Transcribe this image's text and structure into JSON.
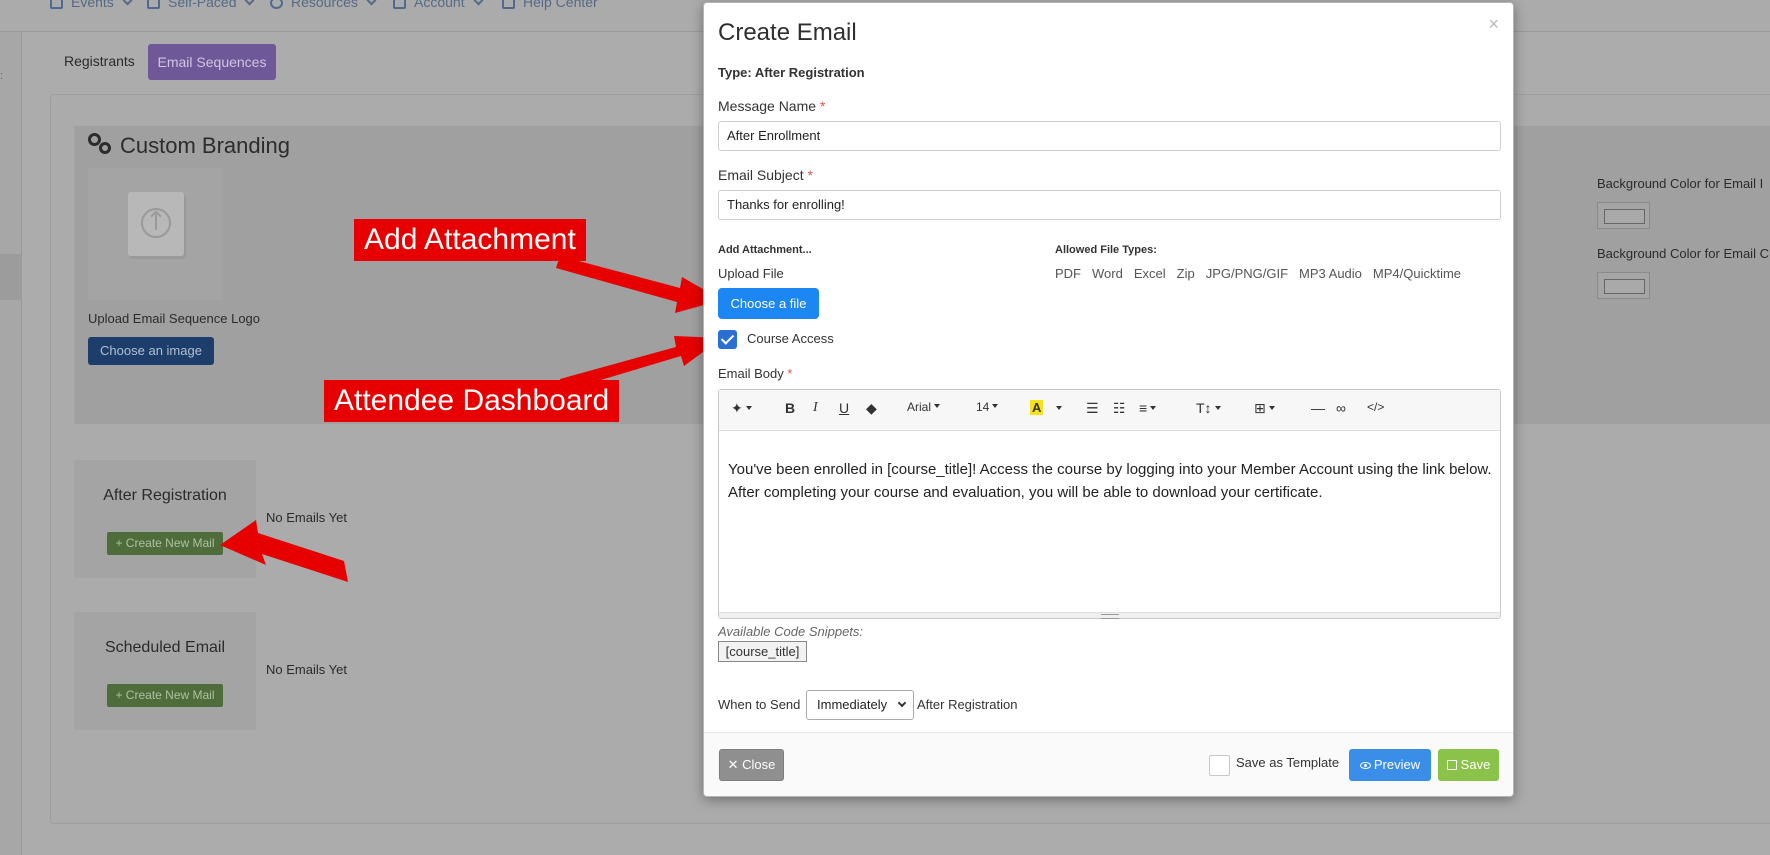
{
  "nav": {
    "items": [
      {
        "label": "Events"
      },
      {
        "label": "Self-Paced"
      },
      {
        "label": "Resources"
      },
      {
        "label": "Account"
      },
      {
        "label": "Help Center"
      }
    ]
  },
  "tabs": {
    "registrants": "Registrants",
    "email_sequences": "Email Sequences"
  },
  "branding": {
    "title": "Custom Branding",
    "upload_logo_label": "Upload Email Sequence Logo",
    "choose_image": "Choose an image",
    "bg_color_label_1": "Background Color for Email I",
    "bg_color_label_2": "Background Color for Email C"
  },
  "sequences": [
    {
      "title": "After Registration",
      "button": "+ Create New Mail",
      "empty": "No Emails Yet"
    },
    {
      "title": "Scheduled Email",
      "button": "+ Create New Mail",
      "empty": "No Emails Yet"
    }
  ],
  "annotations": {
    "add_attachment": "Add Attachment",
    "attendee_dashboard": "Attendee Dashboard",
    "color": "#e60000"
  },
  "modal": {
    "title": "Create Email",
    "close_x": "×",
    "type_line": "Type: After Registration",
    "message_name_label": "Message Name",
    "message_name_value": "After Enrollment",
    "required_mark": "*",
    "email_subject_label": "Email Subject",
    "email_subject_value": "Thanks for enrolling!",
    "add_attachment_label": "Add Attachment...",
    "upload_file_label": "Upload File",
    "choose_file": "Choose a file",
    "allowed_types_label": "Allowed File Types:",
    "allowed_types": [
      "PDF",
      "Word",
      "Excel",
      "Zip",
      "JPG/PNG/GIF",
      "MP3 Audio",
      "MP4/Quicktime"
    ],
    "course_access_label": "Course Access",
    "course_access_checked": true,
    "email_body_label": "Email Body",
    "toolbar": {
      "font": "Arial",
      "size": "14",
      "bold": "B",
      "italic": "I",
      "underline": "U",
      "color_letter": "A",
      "text_size": "T↕",
      "code": "</>"
    },
    "body_text": "You've been enrolled in [course_title]! Access the course by logging into your Member Account using the link below. After completing your course and evaluation, you will be able to download your certificate.",
    "snippets_label": "Available Code Snippets:",
    "snippet": "[course_title]",
    "when_label": "When to Send",
    "when_value": "Immediately",
    "after_label": "After Registration",
    "footer": {
      "close": "✕ Close",
      "save_as_template": "Save as Template",
      "preview": "Preview",
      "save": "Save"
    }
  },
  "colors": {
    "primary_blue": "#1c86f2",
    "preview_blue": "#3b8ee8",
    "save_green": "#8bc34a",
    "close_gray": "#8f8f8f",
    "sequences_purple": "#6f5898",
    "checkbox_blue": "#2a6fd1"
  }
}
